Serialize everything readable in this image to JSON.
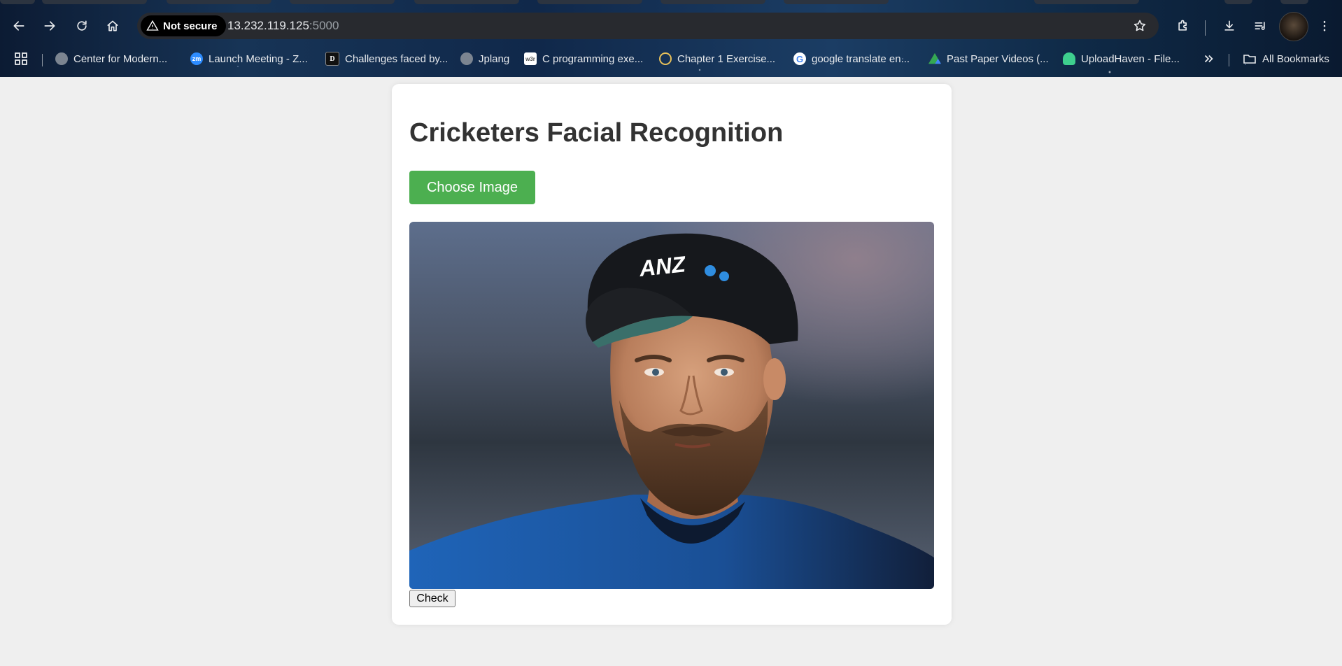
{
  "browser": {
    "security_label": "Not secure",
    "url_host": "13.232.119.125",
    "url_port": ":5000",
    "icons": [
      "back-icon",
      "forward-icon",
      "reload-icon",
      "home-icon",
      "warning-icon",
      "star-icon",
      "extensions-icon",
      "download-icon",
      "reading-list-icon",
      "kebab-menu-icon",
      "apps-grid-icon",
      "chevron-double-right-icon",
      "folder-icon"
    ]
  },
  "bookmarks": {
    "items": [
      {
        "label": "Center for Modern..."
      },
      {
        "label": "Launch Meeting - Z..."
      },
      {
        "label": "Challenges faced by..."
      },
      {
        "label": "Jplang"
      },
      {
        "label": "C programming exe..."
      },
      {
        "label": "Chapter 1 Exercise..."
      },
      {
        "label": "google translate en..."
      },
      {
        "label": "Past Paper Videos (..."
      },
      {
        "label": "UploadHaven - File..."
      }
    ],
    "all_label": "All Bookmarks",
    "zoom_favicon_text": "zm",
    "w3r_favicon_text": "w3r"
  },
  "page": {
    "title": "Cricketers Facial Recognition",
    "choose_button": "Choose Image",
    "check_button": "Check",
    "accent_color": "#4caf50",
    "cap_logo_text": "ANZ"
  }
}
